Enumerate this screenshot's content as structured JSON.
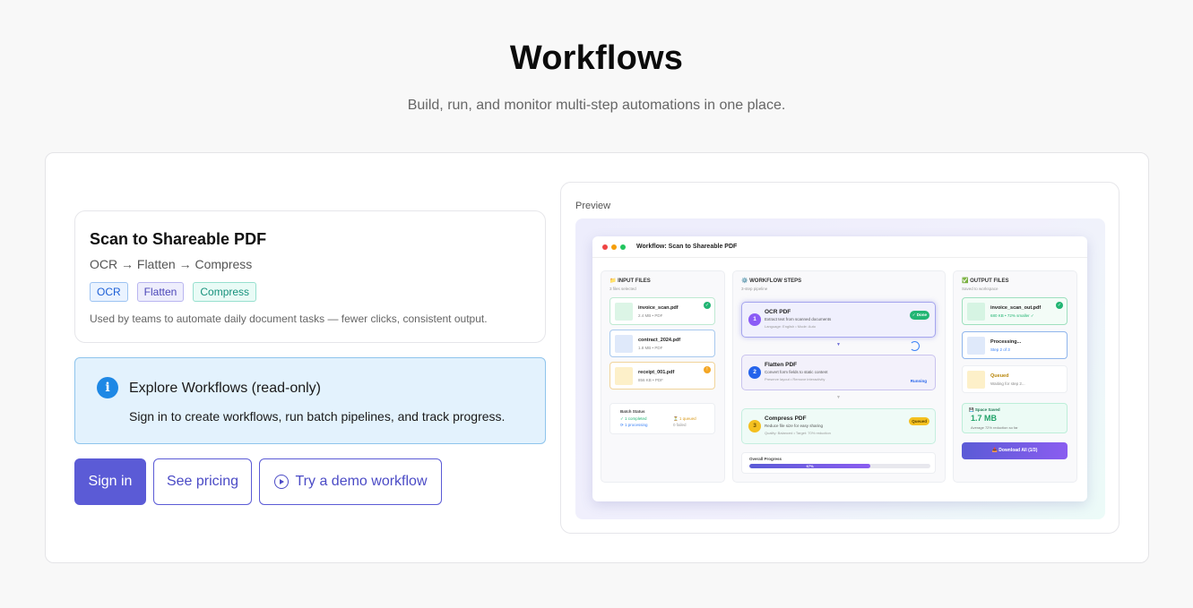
{
  "header": {
    "title": "Workflows",
    "subtitle": "Build, run, and monitor multi-step automations in one place."
  },
  "workflow": {
    "name": "Scan to Shareable PDF",
    "steps": "OCR → Flatten → Compress",
    "tags": [
      "OCR",
      "Flatten",
      "Compress"
    ],
    "description": "Used by teams to automate daily document tasks — fewer clicks, consistent output."
  },
  "info": {
    "icon": "info-icon",
    "title": "Explore Workflows (read-only)",
    "text": "Sign in to create workflows, run batch pipelines, and track progress."
  },
  "buttons": {
    "sign_in": "Sign in",
    "pricing": "See pricing",
    "demo": "Try a demo workflow"
  },
  "preview": {
    "label": "Preview",
    "window_title": "Workflow: Scan to Shareable PDF",
    "input": {
      "heading": "📁 INPUT FILES",
      "sub": "3 files selected",
      "files": [
        {
          "name": "invoice_scan.pdf",
          "meta": "2.4 MB • PDF",
          "badge": "✓"
        },
        {
          "name": "contract_2024.pdf",
          "meta": "1.8 MB • PDF",
          "badge": ""
        },
        {
          "name": "receipt_001.pdf",
          "meta": "856 KB • PDF",
          "badge": "!"
        }
      ],
      "batch": {
        "title": "Batch Status",
        "completed": "✓ 1 completed",
        "queued": "⏳ 1 queued",
        "processing": "⟳ 1 processing",
        "failed": "0 failed"
      }
    },
    "steps": {
      "heading": "⚙️ WORKFLOW STEPS",
      "sub": "3-step pipeline",
      "items": [
        {
          "num": "1",
          "name": "OCR PDF",
          "desc": "Extract text from scanned documents",
          "meta": "Language: English • Mode: Auto",
          "status": "✓ Done"
        },
        {
          "num": "2",
          "name": "Flatten PDF",
          "desc": "Convert form fields to static content",
          "meta": "Preserve layout • Remove interactivity",
          "status": "Running"
        },
        {
          "num": "3",
          "name": "Compress PDF",
          "desc": "Reduce file size for easy sharing",
          "meta": "Quality: Balanced • Target: 70% reduction",
          "status": "Queued"
        }
      ],
      "progress_label": "Overall Progress",
      "progress_percent": 67,
      "progress_text": "67%"
    },
    "output": {
      "heading": "✅ OUTPUT FILES",
      "sub": "Saved to workspace",
      "files": [
        {
          "name": "invoice_scan_out.pdf",
          "meta": "680 KB • 72% smaller ✓"
        },
        {
          "name": "Processing...",
          "meta": "Step 2 of 3"
        },
        {
          "name": "Queued",
          "meta": "Waiting for step 2..."
        }
      ],
      "saved_title": "💾 Space Saved",
      "saved_value": "1.7 MB",
      "saved_note": "Average 72% reduction so far",
      "download": "📥 Download All (1/3)"
    }
  },
  "colors": {
    "accent": "#5b5bd6",
    "info_bg": "#e3f2fd",
    "success": "#22b573",
    "warning": "#f4a623"
  }
}
